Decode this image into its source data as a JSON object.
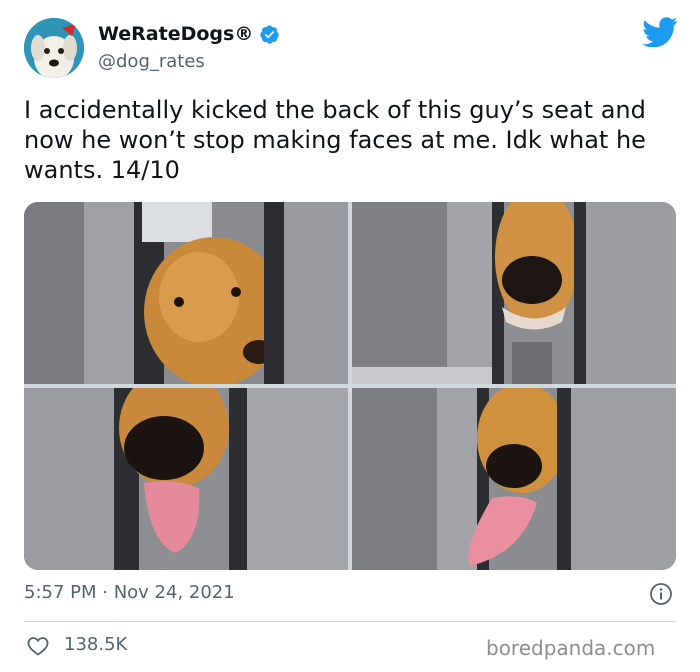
{
  "author": {
    "display_name": "WeRateDogs®",
    "handle": "@dog_rates",
    "verified": true
  },
  "icons": {
    "brand": "twitter-bird-icon",
    "verified": "verified-badge-icon",
    "info": "info-icon",
    "like": "heart-icon"
  },
  "tweet": {
    "text": "I accidentally kicked the back of this guy’s seat and now he won’t stop making faces at me. Idk what he wants. 14/10",
    "timestamp": "5:57 PM · Nov 24, 2021",
    "likes": "138.5K",
    "photo_count": 4
  },
  "watermark": "boredpanda.com",
  "colors": {
    "brand_blue": "#1d9bf0",
    "text_primary": "#0f1419",
    "text_secondary": "#536471",
    "divider": "#cfd9de"
  }
}
